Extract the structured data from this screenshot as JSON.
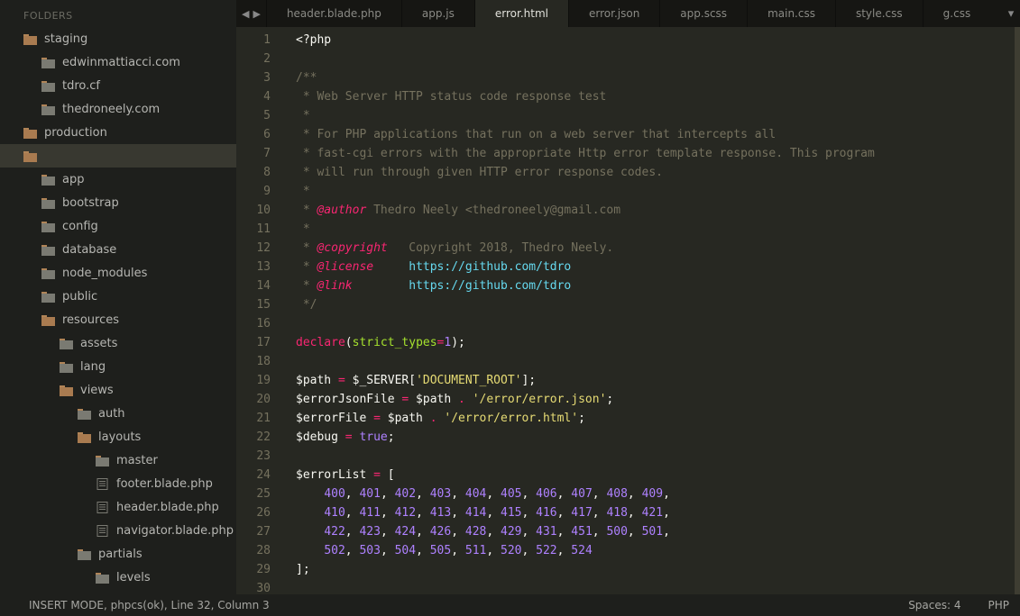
{
  "sidebar": {
    "heading": "FOLDERS",
    "tree": [
      {
        "type": "folder",
        "label": "staging",
        "depth": 0,
        "expanded": true
      },
      {
        "type": "folder",
        "label": "edwinmattiacci.com",
        "depth": 1
      },
      {
        "type": "folder",
        "label": "tdro.cf",
        "depth": 1
      },
      {
        "type": "folder",
        "label": "thedroneely.com",
        "depth": 1
      },
      {
        "type": "folder",
        "label": "production",
        "depth": 0,
        "expanded": true
      },
      {
        "type": "folder",
        "label": "",
        "depth": 0,
        "selected": true,
        "expanded": true
      },
      {
        "type": "folder",
        "label": "app",
        "depth": 1
      },
      {
        "type": "folder",
        "label": "bootstrap",
        "depth": 1
      },
      {
        "type": "folder",
        "label": "config",
        "depth": 1
      },
      {
        "type": "folder",
        "label": "database",
        "depth": 1
      },
      {
        "type": "folder",
        "label": "node_modules",
        "depth": 1
      },
      {
        "type": "folder",
        "label": "public",
        "depth": 1
      },
      {
        "type": "folder",
        "label": "resources",
        "depth": 1,
        "expanded": true
      },
      {
        "type": "folder",
        "label": "assets",
        "depth": 2
      },
      {
        "type": "folder",
        "label": "lang",
        "depth": 2
      },
      {
        "type": "folder",
        "label": "views",
        "depth": 2,
        "expanded": true,
        "accent": true
      },
      {
        "type": "folder",
        "label": "auth",
        "depth": 3
      },
      {
        "type": "folder",
        "label": "layouts",
        "depth": 3,
        "expanded": true
      },
      {
        "type": "folder",
        "label": "master",
        "depth": 4
      },
      {
        "type": "file",
        "label": "footer.blade.php",
        "depth": 4
      },
      {
        "type": "file",
        "label": "header.blade.php",
        "depth": 4
      },
      {
        "type": "file",
        "label": "navigator.blade.php",
        "depth": 4
      },
      {
        "type": "folder",
        "label": "partials",
        "depth": 3
      },
      {
        "type": "folder",
        "label": "levels",
        "depth": 4
      }
    ]
  },
  "tabs": [
    {
      "label": "header.blade.php"
    },
    {
      "label": "app.js"
    },
    {
      "label": "error.html",
      "active": true
    },
    {
      "label": "error.json"
    },
    {
      "label": "app.scss"
    },
    {
      "label": "main.css"
    },
    {
      "label": "style.css"
    },
    {
      "label": "g.css"
    }
  ],
  "tabArrows": {
    "left": "◀",
    "right": "▶",
    "menu": "▾"
  },
  "code": {
    "lines": [
      [
        {
          "c": "var",
          "t": "<?php"
        }
      ],
      [],
      [
        {
          "c": "cm",
          "t": "/**"
        }
      ],
      [
        {
          "c": "cm",
          "t": " * Web Server HTTP status code response test"
        }
      ],
      [
        {
          "c": "cm",
          "t": " *"
        }
      ],
      [
        {
          "c": "cm",
          "t": " * For PHP applications that run on a web server that intercepts all"
        }
      ],
      [
        {
          "c": "cm",
          "t": " * fast-cgi errors with the appropriate Http error template response. This program"
        }
      ],
      [
        {
          "c": "cm",
          "t": " * will run through given HTTP error response codes."
        }
      ],
      [
        {
          "c": "cm",
          "t": " *"
        }
      ],
      [
        {
          "c": "cm",
          "t": " * "
        },
        {
          "c": "tg",
          "t": "@author"
        },
        {
          "c": "cm",
          "t": " Thedro Neely <thedroneely@gmail.com"
        }
      ],
      [
        {
          "c": "cm",
          "t": " *"
        }
      ],
      [
        {
          "c": "cm",
          "t": " * "
        },
        {
          "c": "tg",
          "t": "@copyright"
        },
        {
          "c": "cm",
          "t": "   Copyright 2018, Thedro Neely."
        }
      ],
      [
        {
          "c": "cm",
          "t": " * "
        },
        {
          "c": "tg",
          "t": "@license"
        },
        {
          "c": "cm",
          "t": "     "
        },
        {
          "c": "lk",
          "t": "https://github.com/tdro"
        }
      ],
      [
        {
          "c": "cm",
          "t": " * "
        },
        {
          "c": "tg",
          "t": "@link"
        },
        {
          "c": "cm",
          "t": "        "
        },
        {
          "c": "lk",
          "t": "https://github.com/tdro"
        }
      ],
      [
        {
          "c": "cm",
          "t": " */"
        }
      ],
      [],
      [
        {
          "c": "kw",
          "t": "declare"
        },
        {
          "c": "var",
          "t": "("
        },
        {
          "c": "fn",
          "t": "strict_types"
        },
        {
          "c": "op",
          "t": "="
        },
        {
          "c": "num",
          "t": "1"
        },
        {
          "c": "var",
          "t": ");"
        }
      ],
      [],
      [
        {
          "c": "var",
          "t": "$path "
        },
        {
          "c": "op",
          "t": "="
        },
        {
          "c": "var",
          "t": " $_SERVER["
        },
        {
          "c": "str",
          "t": "'DOCUMENT_ROOT'"
        },
        {
          "c": "var",
          "t": "];"
        }
      ],
      [
        {
          "c": "var",
          "t": "$errorJsonFile "
        },
        {
          "c": "op",
          "t": "="
        },
        {
          "c": "var",
          "t": " $path "
        },
        {
          "c": "op",
          "t": "."
        },
        {
          "c": "var",
          "t": " "
        },
        {
          "c": "str",
          "t": "'/error/error.json'"
        },
        {
          "c": "var",
          "t": ";"
        }
      ],
      [
        {
          "c": "var",
          "t": "$errorFile "
        },
        {
          "c": "op",
          "t": "="
        },
        {
          "c": "var",
          "t": " $path "
        },
        {
          "c": "op",
          "t": "."
        },
        {
          "c": "var",
          "t": " "
        },
        {
          "c": "str",
          "t": "'/error/error.html'"
        },
        {
          "c": "var",
          "t": ";"
        }
      ],
      [
        {
          "c": "var",
          "t": "$debug "
        },
        {
          "c": "op",
          "t": "="
        },
        {
          "c": "var",
          "t": " "
        },
        {
          "c": "num",
          "t": "true"
        },
        {
          "c": "var",
          "t": ";"
        }
      ],
      [],
      [
        {
          "c": "var",
          "t": "$errorList "
        },
        {
          "c": "op",
          "t": "="
        },
        {
          "c": "var",
          "t": " ["
        }
      ],
      [
        {
          "c": "var",
          "t": "    "
        },
        {
          "c": "num",
          "t": "400"
        },
        {
          "c": "var",
          "t": ", "
        },
        {
          "c": "num",
          "t": "401"
        },
        {
          "c": "var",
          "t": ", "
        },
        {
          "c": "num",
          "t": "402"
        },
        {
          "c": "var",
          "t": ", "
        },
        {
          "c": "num",
          "t": "403"
        },
        {
          "c": "var",
          "t": ", "
        },
        {
          "c": "num",
          "t": "404"
        },
        {
          "c": "var",
          "t": ", "
        },
        {
          "c": "num",
          "t": "405"
        },
        {
          "c": "var",
          "t": ", "
        },
        {
          "c": "num",
          "t": "406"
        },
        {
          "c": "var",
          "t": ", "
        },
        {
          "c": "num",
          "t": "407"
        },
        {
          "c": "var",
          "t": ", "
        },
        {
          "c": "num",
          "t": "408"
        },
        {
          "c": "var",
          "t": ", "
        },
        {
          "c": "num",
          "t": "409"
        },
        {
          "c": "var",
          "t": ","
        }
      ],
      [
        {
          "c": "var",
          "t": "    "
        },
        {
          "c": "num",
          "t": "410"
        },
        {
          "c": "var",
          "t": ", "
        },
        {
          "c": "num",
          "t": "411"
        },
        {
          "c": "var",
          "t": ", "
        },
        {
          "c": "num",
          "t": "412"
        },
        {
          "c": "var",
          "t": ", "
        },
        {
          "c": "num",
          "t": "413"
        },
        {
          "c": "var",
          "t": ", "
        },
        {
          "c": "num",
          "t": "414"
        },
        {
          "c": "var",
          "t": ", "
        },
        {
          "c": "num",
          "t": "415"
        },
        {
          "c": "var",
          "t": ", "
        },
        {
          "c": "num",
          "t": "416"
        },
        {
          "c": "var",
          "t": ", "
        },
        {
          "c": "num",
          "t": "417"
        },
        {
          "c": "var",
          "t": ", "
        },
        {
          "c": "num",
          "t": "418"
        },
        {
          "c": "var",
          "t": ", "
        },
        {
          "c": "num",
          "t": "421"
        },
        {
          "c": "var",
          "t": ","
        }
      ],
      [
        {
          "c": "var",
          "t": "    "
        },
        {
          "c": "num",
          "t": "422"
        },
        {
          "c": "var",
          "t": ", "
        },
        {
          "c": "num",
          "t": "423"
        },
        {
          "c": "var",
          "t": ", "
        },
        {
          "c": "num",
          "t": "424"
        },
        {
          "c": "var",
          "t": ", "
        },
        {
          "c": "num",
          "t": "426"
        },
        {
          "c": "var",
          "t": ", "
        },
        {
          "c": "num",
          "t": "428"
        },
        {
          "c": "var",
          "t": ", "
        },
        {
          "c": "num",
          "t": "429"
        },
        {
          "c": "var",
          "t": ", "
        },
        {
          "c": "num",
          "t": "431"
        },
        {
          "c": "var",
          "t": ", "
        },
        {
          "c": "num",
          "t": "451"
        },
        {
          "c": "var",
          "t": ", "
        },
        {
          "c": "num",
          "t": "500"
        },
        {
          "c": "var",
          "t": ", "
        },
        {
          "c": "num",
          "t": "501"
        },
        {
          "c": "var",
          "t": ","
        }
      ],
      [
        {
          "c": "var",
          "t": "    "
        },
        {
          "c": "num",
          "t": "502"
        },
        {
          "c": "var",
          "t": ", "
        },
        {
          "c": "num",
          "t": "503"
        },
        {
          "c": "var",
          "t": ", "
        },
        {
          "c": "num",
          "t": "504"
        },
        {
          "c": "var",
          "t": ", "
        },
        {
          "c": "num",
          "t": "505"
        },
        {
          "c": "var",
          "t": ", "
        },
        {
          "c": "num",
          "t": "511"
        },
        {
          "c": "var",
          "t": ", "
        },
        {
          "c": "num",
          "t": "520"
        },
        {
          "c": "var",
          "t": ", "
        },
        {
          "c": "num",
          "t": "522"
        },
        {
          "c": "var",
          "t": ", "
        },
        {
          "c": "num",
          "t": "524"
        }
      ],
      [
        {
          "c": "var",
          "t": "];"
        }
      ],
      []
    ]
  },
  "status": {
    "left": "INSERT MODE, phpcs(ok), Line 32, Column 3",
    "spaces": "Spaces: 4",
    "syntax": "PHP"
  }
}
